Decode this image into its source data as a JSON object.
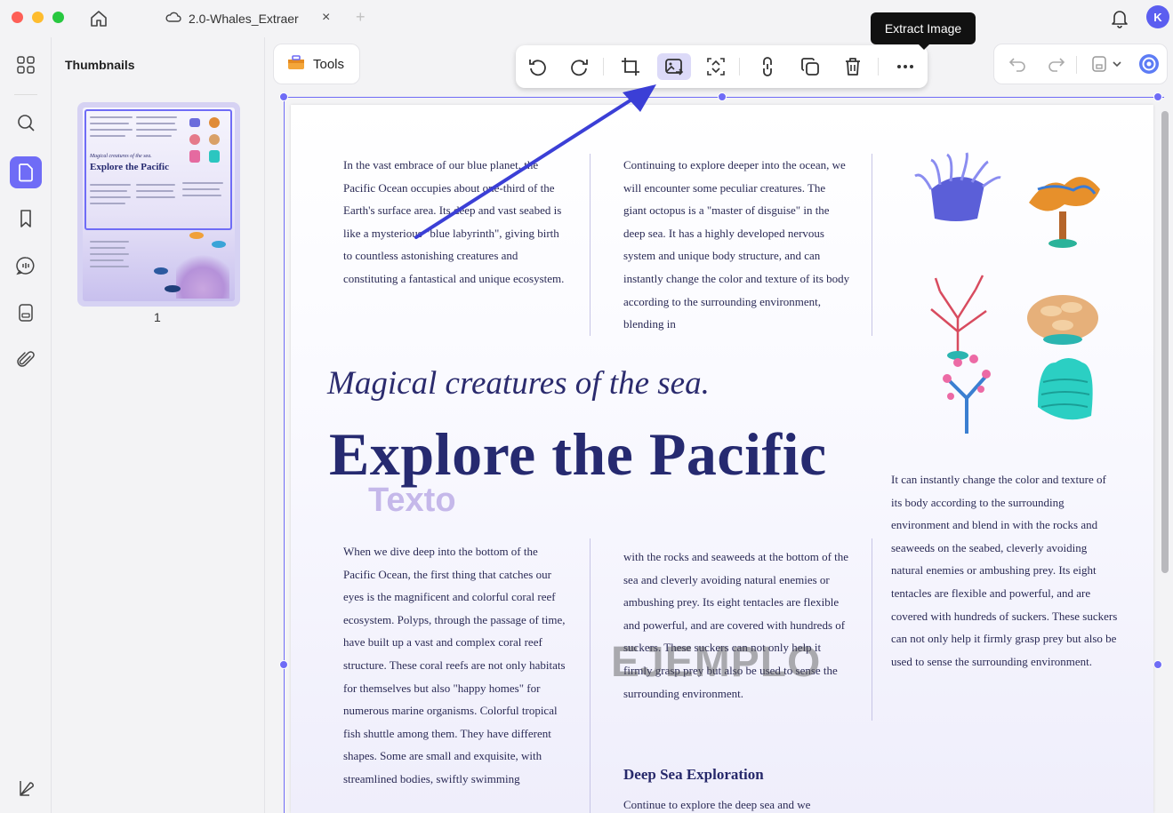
{
  "window": {
    "tab_title": "2.0-Whales_Extraer",
    "tab_close": "×",
    "tab_add": "+",
    "avatar_letter": "K"
  },
  "sidebar": {
    "panel_title": "Thumbnails",
    "page_number": "1",
    "items": [
      {
        "icon": "grid-icon"
      },
      {
        "icon": "search-icon"
      },
      {
        "icon": "page-icon",
        "active": true
      },
      {
        "icon": "bookmark-icon"
      },
      {
        "icon": "comment-icon"
      },
      {
        "icon": "form-icon"
      },
      {
        "icon": "attachment-icon"
      }
    ]
  },
  "toolbar": {
    "tools_label": "Tools",
    "tooltip": "Extract Image",
    "icons": [
      "rotate-left-icon",
      "rotate-right-icon",
      "crop-icon",
      "extract-image-icon",
      "replace-image-icon",
      "link-icon",
      "copy-icon",
      "delete-icon",
      "more-icon"
    ],
    "active_icon": "extract-image-icon"
  },
  "document": {
    "col1_top": "In the vast embrace of our blue planet, the Pacific Ocean occupies about one-third of the Earth's surface area. Its deep and vast seabed is like a mysterious \"blue labyrinth\", giving birth to countless astonishing creatures and constituting a fantastical and unique ecosystem.",
    "col2_top": "Continuing to explore deeper into the ocean, we will encounter some peculiar creatures. The giant octopus is a \"master of disguise\" in the deep sea. It has a highly developed nervous system and unique body structure, and can instantly change the color and texture of its body according to the surrounding environment, blending in",
    "subtitle": "Magical creatures of the sea.",
    "headline": "Explore the Pacific",
    "overlay_text": "Texto",
    "watermark": "EJEMPLO",
    "col1_bottom": "When we dive deep into the bottom of the Pacific Ocean, the first thing that catches our eyes is the magnificent and colorful coral reef ecosystem. Polyps, through the passage of time, have built up a vast and complex coral reef structure. These coral reefs are not only habitats for themselves but also \"happy homes\" for numerous marine organisms. Colorful tropical fish shuttle among them. They have different shapes. Some are small and exquisite, with streamlined bodies, swiftly swimming",
    "col2_bottom": "with the rocks and seaweeds at the bottom of the sea and cleverly avoiding natural enemies or ambushing prey. Its eight tentacles are flexible and powerful, and are covered with hundreds of suckers. These suckers can not only help it firmly grasp prey but also be used to sense the surrounding environment.",
    "section_heading": "Deep Sea Exploration",
    "col2_section_start": "Continue to explore the deep sea and we",
    "col3": "It can instantly change the color and texture of its body according to the surrounding environment and blend in with the rocks and seaweeds on the seabed, cleverly avoiding natural enemies or ambushing prey. Its eight tentacles are flexible and powerful, and are covered with hundreds of suckers. These suckers can not only help it firmly grasp prey but also be used to sense the surrounding environment."
  },
  "colors": {
    "accent": "#6f6cf6",
    "heading": "#262a70",
    "arrow": "#3b3fd6"
  }
}
